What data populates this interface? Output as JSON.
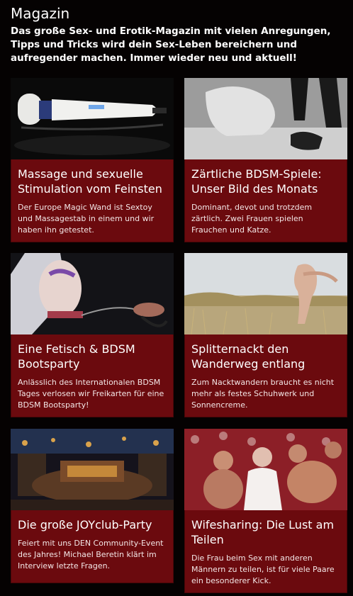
{
  "header": {
    "title": "Magazin",
    "intro": "Das große Sex- und Erotik-Magazin mit vielen Anregungen, Tipps und Tricks wird dein Sex-Leben bereichern und aufregender machen. Immer wieder neu und aktuell!"
  },
  "cards": [
    {
      "title": "Massage und sexuelle Stimulation vom Feinsten",
      "text": "Der Europe Magic Wand ist Sextoy und Massagestab in einem und wir haben ihn getestet.",
      "image": "magic-wand-photo"
    },
    {
      "title": "Zärtliche BDSM-Spiele: Unser Bild des Monats",
      "text": "Dominant, devot und trotzdem zärtlich. Zwei Frauen spielen Frauchen und Katze.",
      "image": "bdsm-photo"
    },
    {
      "title": "Eine Fetisch & BDSM Bootsparty",
      "text": "Anlässlich des Internationalen BDSM Tages verlosen wir Freikarten für eine BDSM Bootsparty!",
      "image": "fetish-collar-photo"
    },
    {
      "title": "Splitternackt den Wanderweg entlang",
      "text": "Zum Nacktwandern braucht es nicht mehr als festes Schuhwerk und Sonnencreme.",
      "image": "meadow-photo"
    },
    {
      "title": "Die große JOYclub-Party",
      "text": "Feiert mit uns DEN Community-Event des Jahres! Michael Beretin klärt im Interview letzte Fragen.",
      "image": "club-venue-photo"
    },
    {
      "title": "Wifesharing: Die Lust am Teilen",
      "text": "Die Frau beim Sex mit anderen Männern zu teilen, ist für viele Paare ein besonderer Kick.",
      "image": "group-photo"
    }
  ],
  "colors": {
    "background": "#050202",
    "card": "#6b0a0e",
    "text": "#ffffff"
  }
}
